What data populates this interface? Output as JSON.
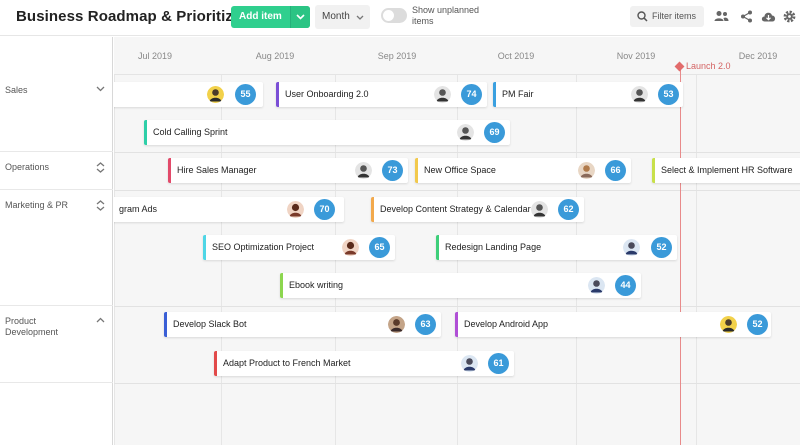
{
  "header": {
    "title": "Business Roadmap & Prioritization",
    "add_item_label": "Add item",
    "view_select": "Month",
    "toggle_label": "Show unplanned items",
    "filter_placeholder": "Filter items"
  },
  "groups": [
    {
      "label": "Sales"
    },
    {
      "label": "Operations"
    },
    {
      "label": "Marketing & PR"
    },
    {
      "label": "Product Development"
    }
  ],
  "months": [
    "Jul 2019",
    "Aug 2019",
    "Sep 2019",
    "Oct 2019",
    "Nov 2019",
    "Dec 2019"
  ],
  "milestone": {
    "label": "Launch 2.0"
  },
  "items": [
    {
      "name": "",
      "score": "55",
      "color": "#999999"
    },
    {
      "name": "User Onboarding 2.0",
      "score": "74",
      "color": "#7b4fd6"
    },
    {
      "name": "PM Fair",
      "score": "53",
      "color": "#3aa0e0"
    },
    {
      "name": "Cold Calling Sprint",
      "score": "69",
      "color": "#2ecfa8"
    },
    {
      "name": "Hire Sales Manager",
      "score": "73",
      "color": "#e24a6a"
    },
    {
      "name": "New Office Space",
      "score": "66",
      "color": "#f2c94c"
    },
    {
      "name": "Select & Implement HR Software",
      "score": "",
      "color": "#c8e04a"
    },
    {
      "name": "gram Ads",
      "score": "70",
      "color": "#999999"
    },
    {
      "name": "Develop Content Strategy & Calendar",
      "score": "62",
      "color": "#f2a94c"
    },
    {
      "name": "SEO Optimization Project",
      "score": "65",
      "color": "#4fd6e6"
    },
    {
      "name": "Redesign Landing Page",
      "score": "52",
      "color": "#3ecf7a"
    },
    {
      "name": "Ebook writing",
      "score": "44",
      "color": "#8cd64f"
    },
    {
      "name": "Develop Slack Bot",
      "score": "63",
      "color": "#3a5fd6"
    },
    {
      "name": "Develop Android App",
      "score": "52",
      "color": "#b04fd6"
    },
    {
      "name": "Adapt Product to French Market",
      "score": "61",
      "color": "#e24a4a"
    }
  ]
}
